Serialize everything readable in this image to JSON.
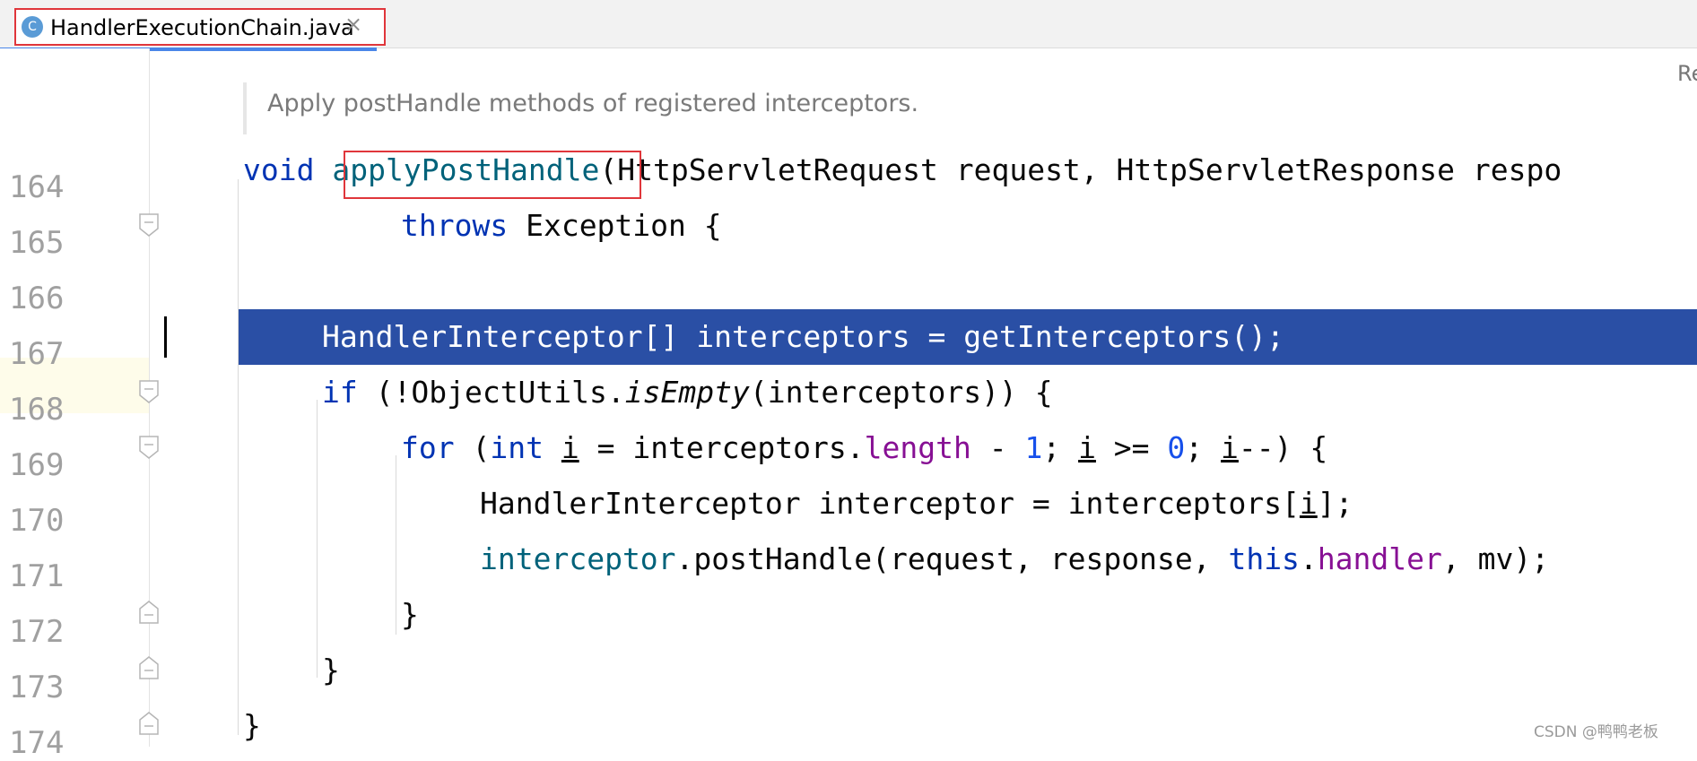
{
  "tab": {
    "title": "HandlerExecutionChain.java",
    "icon_letter": "C",
    "close": "×"
  },
  "doc_comment": "Apply postHandle methods of registered interceptors.",
  "right_hint": "Re",
  "line_numbers": [
    "164",
    "165",
    "166",
    "167",
    "168",
    "169",
    "170",
    "171",
    "172",
    "173",
    "174"
  ],
  "code": {
    "l164": {
      "kw": "void",
      "method": "applyPostHandle",
      "rest": "(HttpServletRequest request, HttpServletResponse respo"
    },
    "l165": {
      "kw": "throws",
      "rest": " Exception {"
    },
    "l167": {
      "text": "HandlerInterceptor[] interceptors = getInterceptors();"
    },
    "l168": {
      "kw": "if",
      "a": " (!ObjectUtils.",
      "static_call": "isEmpty",
      "b": "(interceptors)) {"
    },
    "l169": {
      "kw": "for",
      "a": " (",
      "kw2": "int",
      "sp": " ",
      "var": "i",
      "b": " = interceptors.",
      "field": "length",
      "c": " - ",
      "n1": "1",
      "d": "; ",
      "var2": "i",
      "e": " >= ",
      "n0": "0",
      "f": "; ",
      "var3": "i",
      "g": "--) {"
    },
    "l170": {
      "a": "HandlerInterceptor interceptor = interceptors[",
      "var": "i",
      "b": "];"
    },
    "l171": {
      "local": "interceptor",
      "a": ".postHandle(request, response, ",
      "kw": "this",
      "dot": ".",
      "field": "handler",
      "b": ", mv);"
    },
    "l172": {
      "text": "}"
    },
    "l173": {
      "text": "}"
    },
    "l174": {
      "text": "}"
    }
  },
  "watermark": "CSDN @鸭鸭老板",
  "colors": {
    "selection": "#2a4fa5",
    "keyword": "#0033b3",
    "method": "#00627a",
    "field": "#871094",
    "number": "#1750eb",
    "highlight_box": "#e0363b"
  }
}
